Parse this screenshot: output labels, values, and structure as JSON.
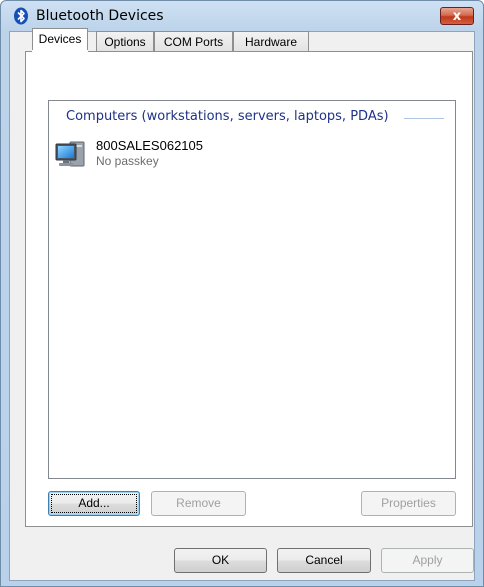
{
  "window": {
    "title": "Bluetooth Devices",
    "close_label": "x"
  },
  "tabs": [
    {
      "label": "Devices",
      "active": true
    },
    {
      "label": "Options",
      "active": false
    },
    {
      "label": "COM Ports",
      "active": false
    },
    {
      "label": "Hardware",
      "active": false
    }
  ],
  "device_list": {
    "group_header": "Computers (workstations, servers, laptops, PDAs)",
    "devices": [
      {
        "name": "800SALES062105",
        "status": "No passkey",
        "icon": "computer-icon"
      }
    ]
  },
  "panel_buttons": {
    "add": "Add...",
    "remove": "Remove",
    "properties": "Properties"
  },
  "dialog_buttons": {
    "ok": "OK",
    "cancel": "Cancel",
    "apply": "Apply"
  },
  "colors": {
    "group_header": "#1e3287",
    "titlebar": "#bcd3ea",
    "close_button": "#c0391c"
  }
}
